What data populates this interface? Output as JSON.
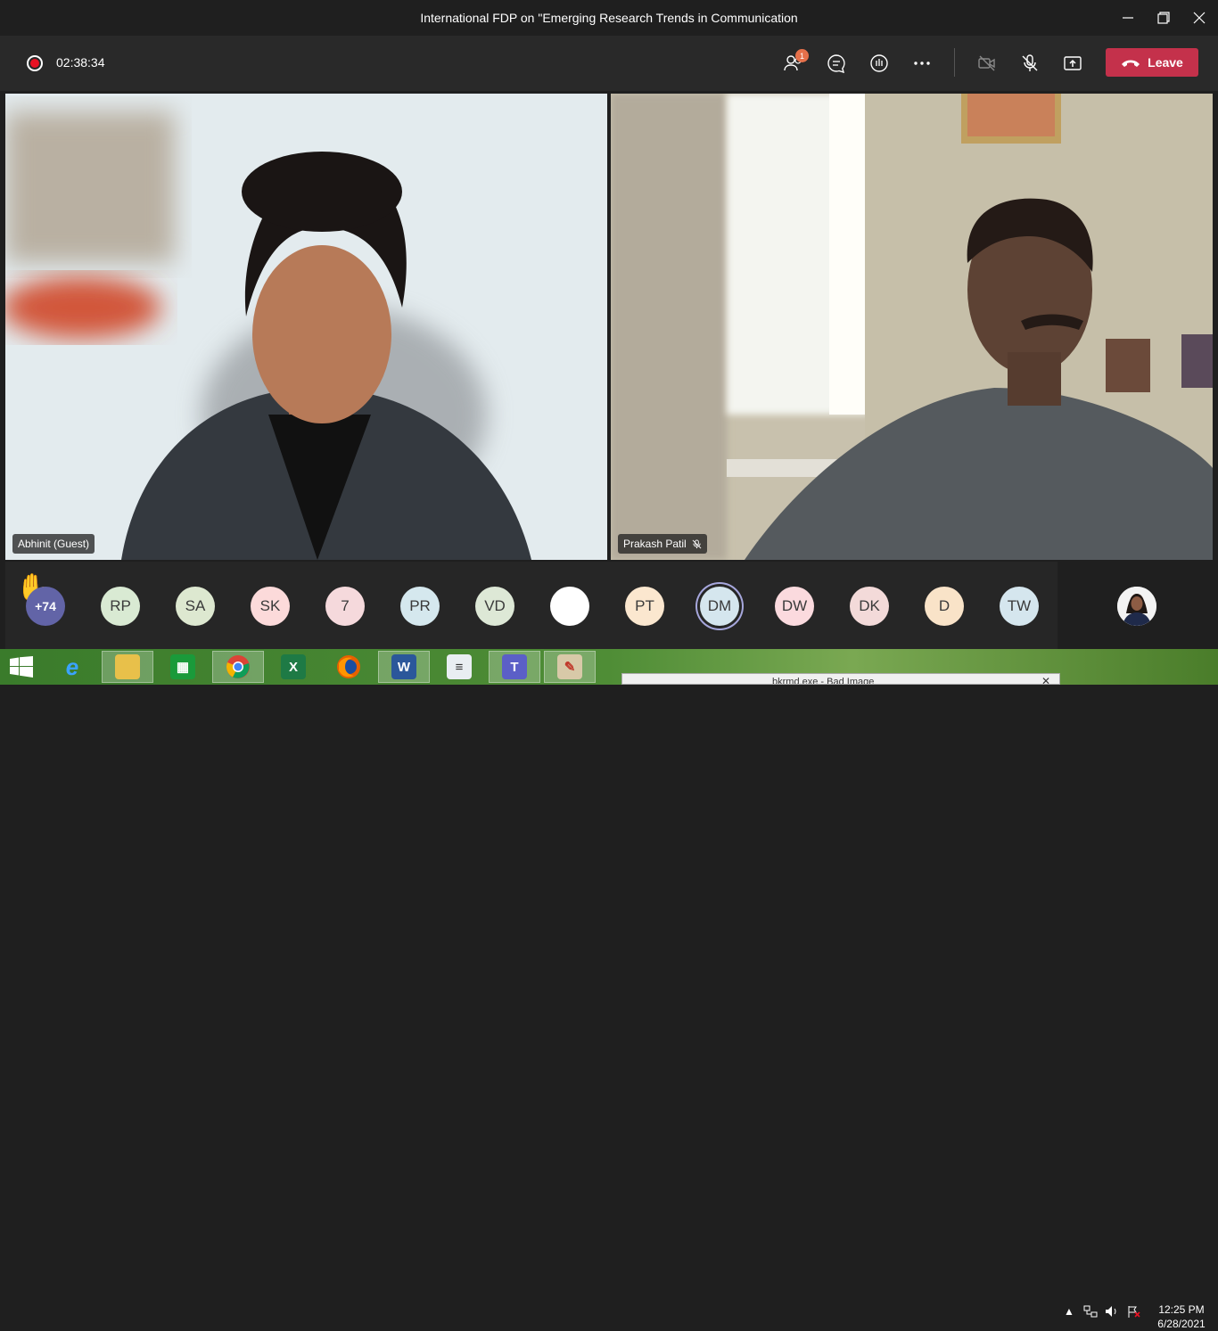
{
  "window": {
    "title": "International FDP on \"Emerging Research Trends in Communication"
  },
  "toolbar": {
    "recording_timer": "02:38:34",
    "participants_badge": "1",
    "leave_label": "Leave"
  },
  "videos": [
    {
      "name": "Abhinit (Guest)",
      "muted": false
    },
    {
      "name": "Prakash Patil",
      "muted": true
    }
  ],
  "participants": {
    "overflow_count": "+74",
    "avatars": [
      {
        "initials": "RP",
        "color": "#d9ead3"
      },
      {
        "initials": "SA",
        "color": "#dde8d0"
      },
      {
        "initials": "SK",
        "color": "#fcdada"
      },
      {
        "initials": "7",
        "color": "#f5d9dc"
      },
      {
        "initials": "PR",
        "color": "#d5e8ee"
      },
      {
        "initials": "VD",
        "color": "#dde8d6"
      },
      {
        "initials": "",
        "color": "#ffffff"
      },
      {
        "initials": "PT",
        "color": "#fbe7cf"
      },
      {
        "initials": "DM",
        "color": "#d5e6ee"
      },
      {
        "initials": "DW",
        "color": "#fbdade"
      },
      {
        "initials": "DK",
        "color": "#f3dad9"
      },
      {
        "initials": "D",
        "color": "#f9e3c8"
      },
      {
        "initials": "TW",
        "color": "#d5e6ee"
      }
    ]
  },
  "taskbar": {
    "popup_text": "bkrmd.exe - Bad Image",
    "time": "12:25 PM",
    "date": "6/28/2021"
  }
}
